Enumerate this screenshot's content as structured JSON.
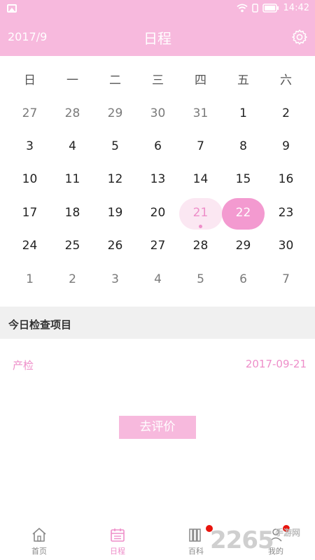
{
  "status_bar": {
    "time": "14:42"
  },
  "header": {
    "month": "2017/9",
    "title": "日程"
  },
  "calendar": {
    "weekdays": [
      "日",
      "一",
      "二",
      "三",
      "四",
      "五",
      "六"
    ],
    "weeks": [
      [
        "27",
        "28",
        "29",
        "30",
        "31",
        "1",
        "2"
      ],
      [
        "3",
        "4",
        "5",
        "6",
        "7",
        "8",
        "9"
      ],
      [
        "10",
        "11",
        "12",
        "13",
        "14",
        "15",
        "16"
      ],
      [
        "17",
        "18",
        "19",
        "20",
        "21",
        "22",
        "23"
      ],
      [
        "24",
        "25",
        "26",
        "27",
        "28",
        "29",
        "30"
      ],
      [
        "1",
        "2",
        "3",
        "4",
        "5",
        "6",
        "7"
      ]
    ],
    "today": "21",
    "selected": "22"
  },
  "section": {
    "title": "今日检查项目"
  },
  "exam_item": {
    "name": "产检",
    "date": "2017-09-21"
  },
  "review_button": {
    "label": "去评价"
  },
  "tabs": [
    {
      "label": "首页",
      "icon": "home-icon"
    },
    {
      "label": "日程",
      "icon": "calendar-icon"
    },
    {
      "label": "百科",
      "icon": "books-icon"
    },
    {
      "label": "我的",
      "icon": "profile-icon"
    }
  ],
  "watermark": {
    "main": "2265",
    "sub": "手游网"
  },
  "colors": {
    "brand_pink": "#f7b9dd",
    "accent_pink": "#ee8ec9",
    "selected_pink": "#f39ad0"
  }
}
